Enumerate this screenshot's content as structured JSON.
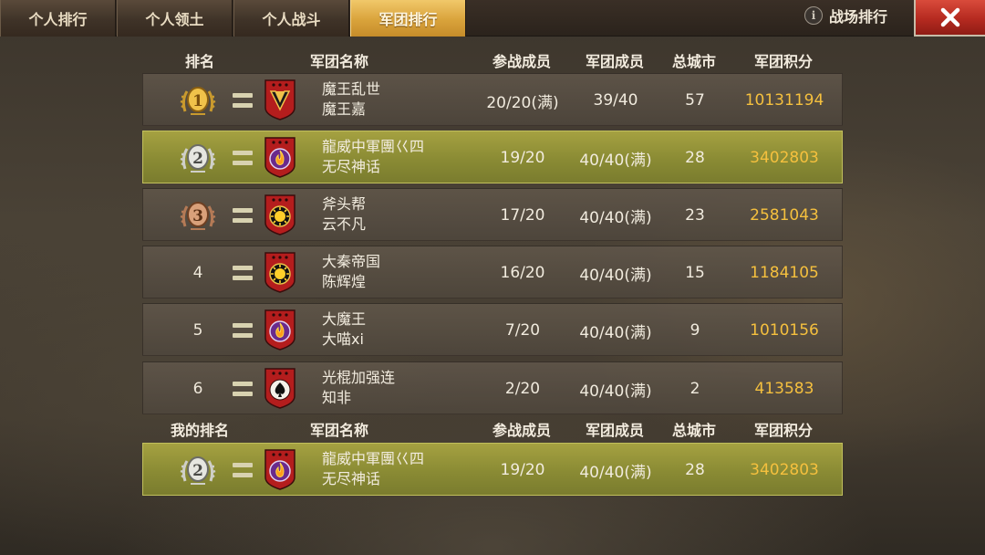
{
  "tabs": [
    {
      "label": "个人排行",
      "active": false
    },
    {
      "label": "个人领土",
      "active": false
    },
    {
      "label": "个人战斗",
      "active": false
    },
    {
      "label": "军团排行",
      "active": true
    }
  ],
  "battle_rank_label": "战场排行",
  "info_glyph": "i",
  "columns": {
    "rank": "排名",
    "my_rank": "我的排名",
    "name": "军团名称",
    "participants": "参战成员",
    "members": "军团成员",
    "cities": "总城市",
    "score": "军团积分"
  },
  "rows": [
    {
      "rank": "1",
      "medal": "gold",
      "trend": "equal",
      "emblem": "chevron",
      "name": "魔王乱世",
      "leader": "魔王嘉",
      "participants": "20/20(满)",
      "members": "39/40",
      "cities": "57",
      "score": "10131194",
      "highlight": false
    },
    {
      "rank": "2",
      "medal": "silver",
      "trend": "equal",
      "emblem": "flame",
      "name": "龍威中軍團巜四",
      "leader": "无尽神话",
      "participants": "19/20",
      "members": "40/40(满)",
      "cities": "28",
      "score": "3402803",
      "highlight": true
    },
    {
      "rank": "3",
      "medal": "bronze",
      "trend": "equal",
      "emblem": "sun",
      "name": "斧头帮",
      "leader": "云不凡",
      "participants": "17/20",
      "members": "40/40(满)",
      "cities": "23",
      "score": "2581043",
      "highlight": false
    },
    {
      "rank": "4",
      "medal": "",
      "trend": "equal",
      "emblem": "sun",
      "name": "大秦帝国",
      "leader": "陈辉煌",
      "participants": "16/20",
      "members": "40/40(满)",
      "cities": "15",
      "score": "1184105",
      "highlight": false
    },
    {
      "rank": "5",
      "medal": "",
      "trend": "equal",
      "emblem": "flame",
      "name": "大魔王",
      "leader": "大喵xi",
      "participants": "7/20",
      "members": "40/40(满)",
      "cities": "9",
      "score": "1010156",
      "highlight": false
    },
    {
      "rank": "6",
      "medal": "",
      "trend": "equal",
      "emblem": "spade",
      "name": "光棍加强连",
      "leader": "知非",
      "participants": "2/20",
      "members": "40/40(满)",
      "cities": "2",
      "score": "413583",
      "highlight": false
    }
  ],
  "my_row": {
    "rank": "2",
    "medal": "silver",
    "trend": "equal",
    "emblem": "flame",
    "name": "龍威中軍團巜四",
    "leader": "无尽神话",
    "participants": "19/20",
    "members": "40/40(满)",
    "cities": "28",
    "score": "3402803"
  },
  "colors": {
    "score": "#f5c03e",
    "active_tab": "#d9a33b",
    "highlight_row": "#8a8b34",
    "close_button": "#b52a20"
  }
}
